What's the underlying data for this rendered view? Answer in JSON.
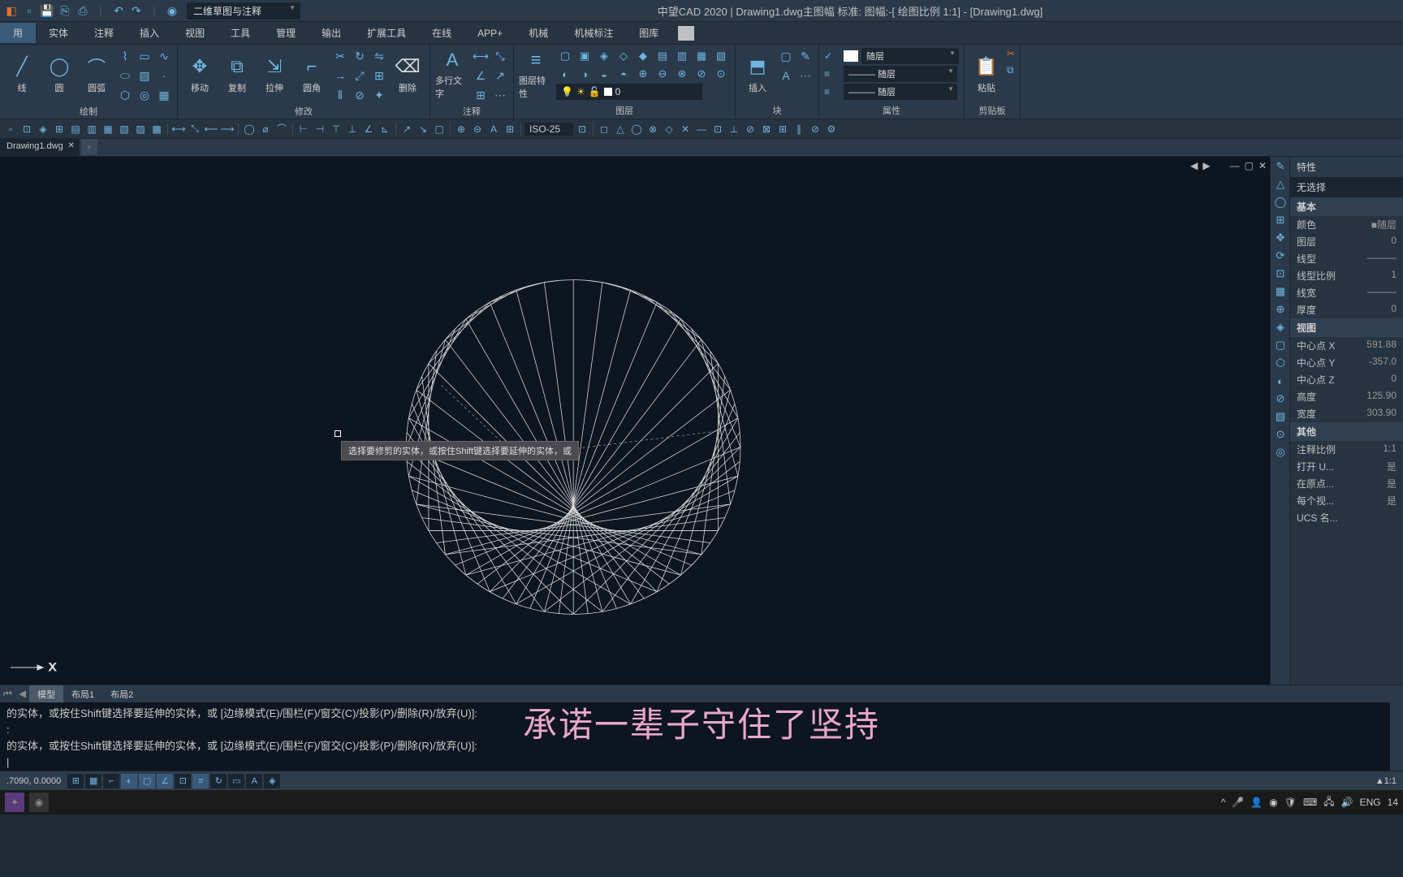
{
  "titlebar": {
    "workspace_dropdown": "二维草图与注释",
    "title": "中望CAD 2020 | Drawing1.dwg主图幅  标准: 图幅:-[ 绘图比例 1:1] - [Drawing1.dwg]"
  },
  "menu": {
    "items": [
      "用",
      "实体",
      "注释",
      "插入",
      "视图",
      "工具",
      "管理",
      "输出",
      "扩展工具",
      "在线",
      "APP+",
      "机械",
      "机械标注",
      "图库"
    ]
  },
  "ribbon": {
    "groups": {
      "draw": {
        "label": "绘制",
        "line": "线",
        "circle": "圆",
        "arc": "圆弧"
      },
      "modify": {
        "label": "修改",
        "move": "移动",
        "copy": "复制",
        "stretch": "拉伸",
        "fillet": "圆角",
        "delete": "删除"
      },
      "annotate": {
        "label": "注释",
        "mtext": "多行文字"
      },
      "layer": {
        "label": "图层",
        "props": "图层特性",
        "current": "0"
      },
      "block": {
        "label": "块",
        "insert": "插入"
      },
      "props": {
        "label": "属性",
        "color": "随层",
        "ltype": "随层",
        "lweight": "随层"
      },
      "clipboard": {
        "label": "剪贴板",
        "paste": "粘贴"
      }
    }
  },
  "toolbar2": {
    "iso": "ISO-25"
  },
  "tabs": {
    "file": "Drawing1.dwg"
  },
  "canvas": {
    "tooltip": "选择要修剪的实体，或按住Shift键选择要延伸的实体，或",
    "ucs_x": "X"
  },
  "prop_panel": {
    "title": "特性",
    "selection": "无选择",
    "sections": {
      "basic": "基本",
      "view": "视图",
      "other": "其他"
    },
    "basic": {
      "color_k": "颜色",
      "color_v": "■随层",
      "layer_k": "图层",
      "layer_v": "0",
      "ltype_k": "线型",
      "ltype_v": "———",
      "lscale_k": "线型比例",
      "lscale_v": "1",
      "lweight_k": "线宽",
      "lweight_v": "———",
      "thick_k": "厚度",
      "thick_v": "0"
    },
    "view": {
      "cx_k": "中心点 X",
      "cx_v": "591.88",
      "cy_k": "中心点 Y",
      "cy_v": "-357.0",
      "cz_k": "中心点 Z",
      "cz_v": "0",
      "h_k": "高度",
      "h_v": "125.90",
      "w_k": "宽度",
      "w_v": "303.90"
    },
    "other": {
      "ann_k": "注释比例",
      "ann_v": "1:1",
      "open_k": "打开 U...",
      "open_v": "是",
      "origin_k": "在原点...",
      "origin_v": "是",
      "pvp_k": "每个视...",
      "pvp_v": "是",
      "ucs_k": "UCS 名...",
      "ucs_v": ""
    }
  },
  "layout_tabs": {
    "model": "模型",
    "l1": "布局1",
    "l2": "布局2"
  },
  "cmdline": {
    "l1": "的实体，或按住Shift键选择要延伸的实体，或 [边缘模式(E)/围栏(F)/窗交(C)/投影(P)/删除(R)/放弃(U)]:",
    "l2": ":",
    "l3": "的实体，或按住Shift键选择要延伸的实体，或 [边缘模式(E)/围栏(F)/窗交(C)/投影(P)/删除(R)/放弃(U)]:"
  },
  "statusbar": {
    "coords": ".7090, 0.0000",
    "scale": "▲1:1",
    "lang": "ENG",
    "time": "14"
  },
  "overlay": "承诺一辈子守住了坚持"
}
